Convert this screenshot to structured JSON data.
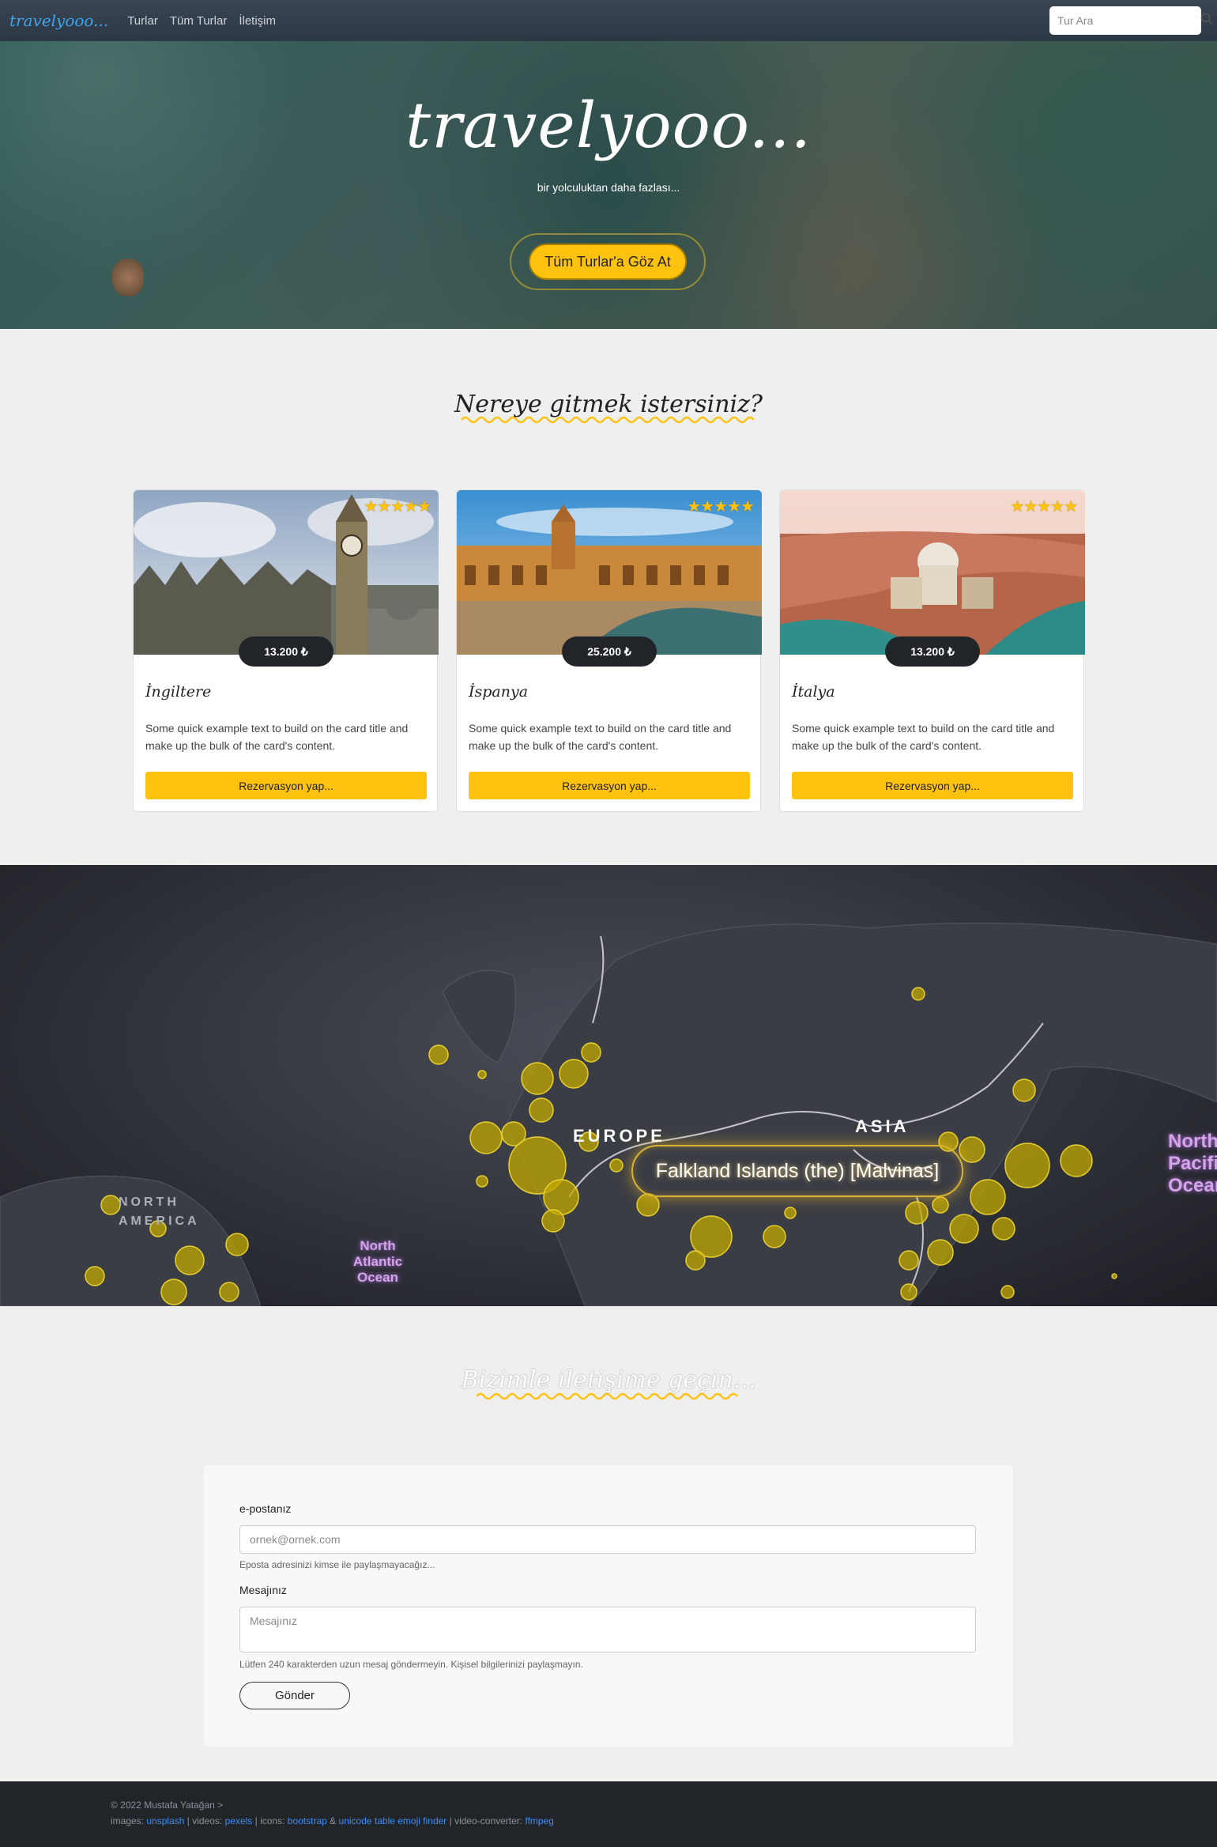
{
  "nav": {
    "brand": "travelyooo...",
    "links": [
      "Turlar",
      "Tüm Turlar",
      "İletişim"
    ],
    "search_placeholder": "Tur Ara"
  },
  "hero": {
    "title": "travelyooo...",
    "subtitle": "bir yolculuktan daha fazlası...",
    "button": "Tüm Turlar'a Göz At"
  },
  "destinations": {
    "title": "Nereye gitmek istersiniz?",
    "cards": [
      {
        "title": "İngiltere",
        "price": "13.200 ₺",
        "stars": "★★★★★",
        "rating": 5,
        "text": "Some quick example text to build on the card title and make up the bulk of the card's content.",
        "button": "Rezervasyon yap..."
      },
      {
        "title": "İspanya",
        "price": "25.200 ₺",
        "stars": "★★★★★",
        "rating": 5,
        "text": "Some quick example text to build on the card title and make up the bulk of the card's content.",
        "button": "Rezervasyon yap..."
      },
      {
        "title": "İtalya",
        "price": "13.200 ₺",
        "stars": "★★★★★",
        "rating": 5,
        "text": "Some quick example text to build on the card title and make up the bulk of the card's content.",
        "button": "Rezervasyon yap..."
      }
    ]
  },
  "map": {
    "highlight": "Falkland Islands (the) [Malvinas]",
    "regions": [
      "EUROPE",
      "ASIA",
      "NORTH AMERICA"
    ],
    "oceans": [
      "North Atlantic Ocean",
      "North Pacific Ocean"
    ]
  },
  "contact": {
    "title": "Bizimle iletişime geçin...",
    "email_label": "e-postanız",
    "email_placeholder": "ornek@ornek.com",
    "email_help": "Eposta adresinizi kimse ile paylaşmayacağız...",
    "message_label": "Mesajınız",
    "message_placeholder": "Mesajınız",
    "message_help": "Lütfen 240 karakterden uzun mesaj göndermeyin. Kişisel bilgilerinizi paylaşmayın.",
    "send": "Gönder"
  },
  "footer": {
    "copyright": "© 2022 Mustafa Yatağan >",
    "images_label": "images:",
    "images_link": "unsplash",
    "videos_label": "| videos:",
    "videos_link": "pexels",
    "icons_label": "| icons:",
    "icons_link1": "bootstrap",
    "amp": "&",
    "icons_link2": "unicode table emoji finder",
    "converter_label": "| video-converter:",
    "converter_link": "ffmpeg"
  },
  "colors": {
    "accent": "#ffc20e",
    "brand": "#3ea4ee",
    "dark": "#212429"
  }
}
